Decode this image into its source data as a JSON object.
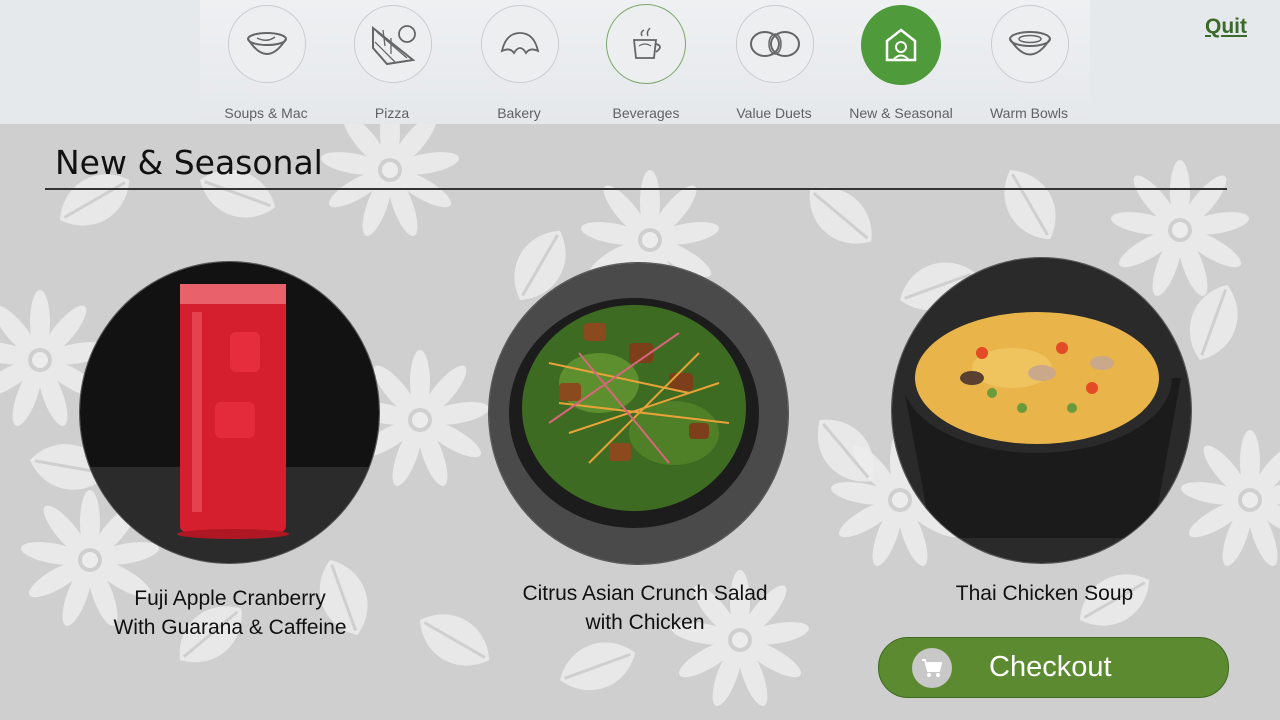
{
  "categories": [
    {
      "label": "Soups & Mac",
      "icon": "soup-bowl-icon"
    },
    {
      "label": "Pizza",
      "icon": "pizza-icon"
    },
    {
      "label": "Bakery",
      "icon": "croissant-icon"
    },
    {
      "label": "Beverages",
      "icon": "coffee-cup-icon"
    },
    {
      "label": "Value Duets",
      "icon": "rings-icon"
    },
    {
      "label": "New & Seasonal",
      "icon": "new-seasonal-icon",
      "selected": true
    },
    {
      "label": "Warm Bowls",
      "icon": "warm-bowl-icon"
    }
  ],
  "quit_label": "Quit",
  "section_title": "New & Seasonal",
  "items": [
    {
      "name_line1": "Fuji Apple Cranberry",
      "name_line2": "With Guarana & Caffeine"
    },
    {
      "name_line1": "Citrus Asian Crunch Salad",
      "name_line2": "with Chicken"
    },
    {
      "name_line1": "Thai Chicken Soup",
      "name_line2": ""
    }
  ],
  "checkout_label": "Checkout",
  "colors": {
    "accent_green": "#5c8a30",
    "selected_green": "#4f9a3a",
    "quit_green": "#3c6a2a"
  }
}
